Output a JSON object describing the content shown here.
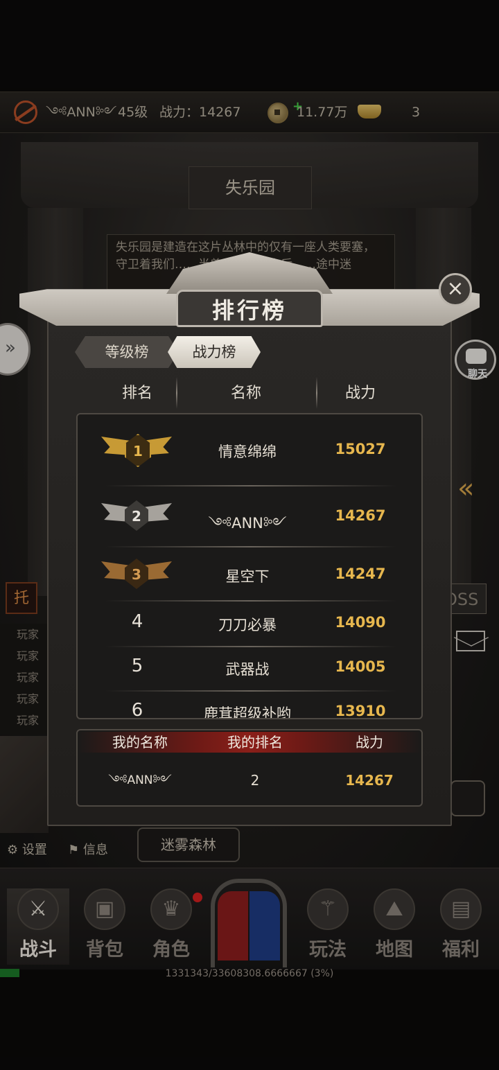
{
  "topbar": {
    "player_name": "༺ANN༻",
    "level": "45级",
    "power_label": "战力：14267",
    "copper": "11.77万",
    "gold": "3"
  },
  "scene": {
    "place_title": "失乐园",
    "place_desc": "失乐园是建造在这片丛林中的仅有一座人类要塞，守卫着我们……半兽人被击败之后……途中迷",
    "chat_button": "聊天",
    "boss_tag": "OSS",
    "tuo_icon": "托",
    "chat_log": [
      "玩家",
      "玩家",
      "玩家",
      "玩家",
      "玩家"
    ],
    "settings": "设置",
    "info": "信息",
    "fog_forest": "迷雾森林"
  },
  "bottom_nav": [
    {
      "label": "战斗",
      "icon": "swords-icon"
    },
    {
      "label": "背包",
      "icon": "backpack-icon"
    },
    {
      "label": "角色",
      "icon": "helmet-icon"
    },
    {
      "label": "玩法",
      "icon": "sword-circle-icon"
    },
    {
      "label": "地图",
      "icon": "map-icon"
    },
    {
      "label": "福利",
      "icon": "chest-icon"
    }
  ],
  "progress": {
    "text": "1331343/33608308.6666667 (3%)",
    "percent": 3
  },
  "dialog": {
    "title": "排行榜",
    "tabs": [
      {
        "label": "等级榜",
        "active": false
      },
      {
        "label": "战力榜",
        "active": true
      }
    ],
    "columns": {
      "rank": "排名",
      "name": "名称",
      "power": "战力"
    },
    "rows": [
      {
        "rank": "1",
        "name": "情意绵绵",
        "power": "15027"
      },
      {
        "rank": "2",
        "name": "༺ANN༻",
        "power": "14267"
      },
      {
        "rank": "3",
        "name": "星空下",
        "power": "14247"
      },
      {
        "rank": "4",
        "name": "刀刀必暴",
        "power": "14090"
      },
      {
        "rank": "5",
        "name": "武器战",
        "power": "14005"
      },
      {
        "rank": "6",
        "name": "鹿茸超级补哟",
        "power": "13910"
      }
    ],
    "mine": {
      "name_label": "我的名称",
      "rank_label": "我的排名",
      "power_label": "战力",
      "name": "༺ANN༻",
      "rank": "2",
      "power": "14267"
    }
  },
  "colors": {
    "power_gold": "#e7b74e",
    "my_header_red": "#8a1f19"
  }
}
